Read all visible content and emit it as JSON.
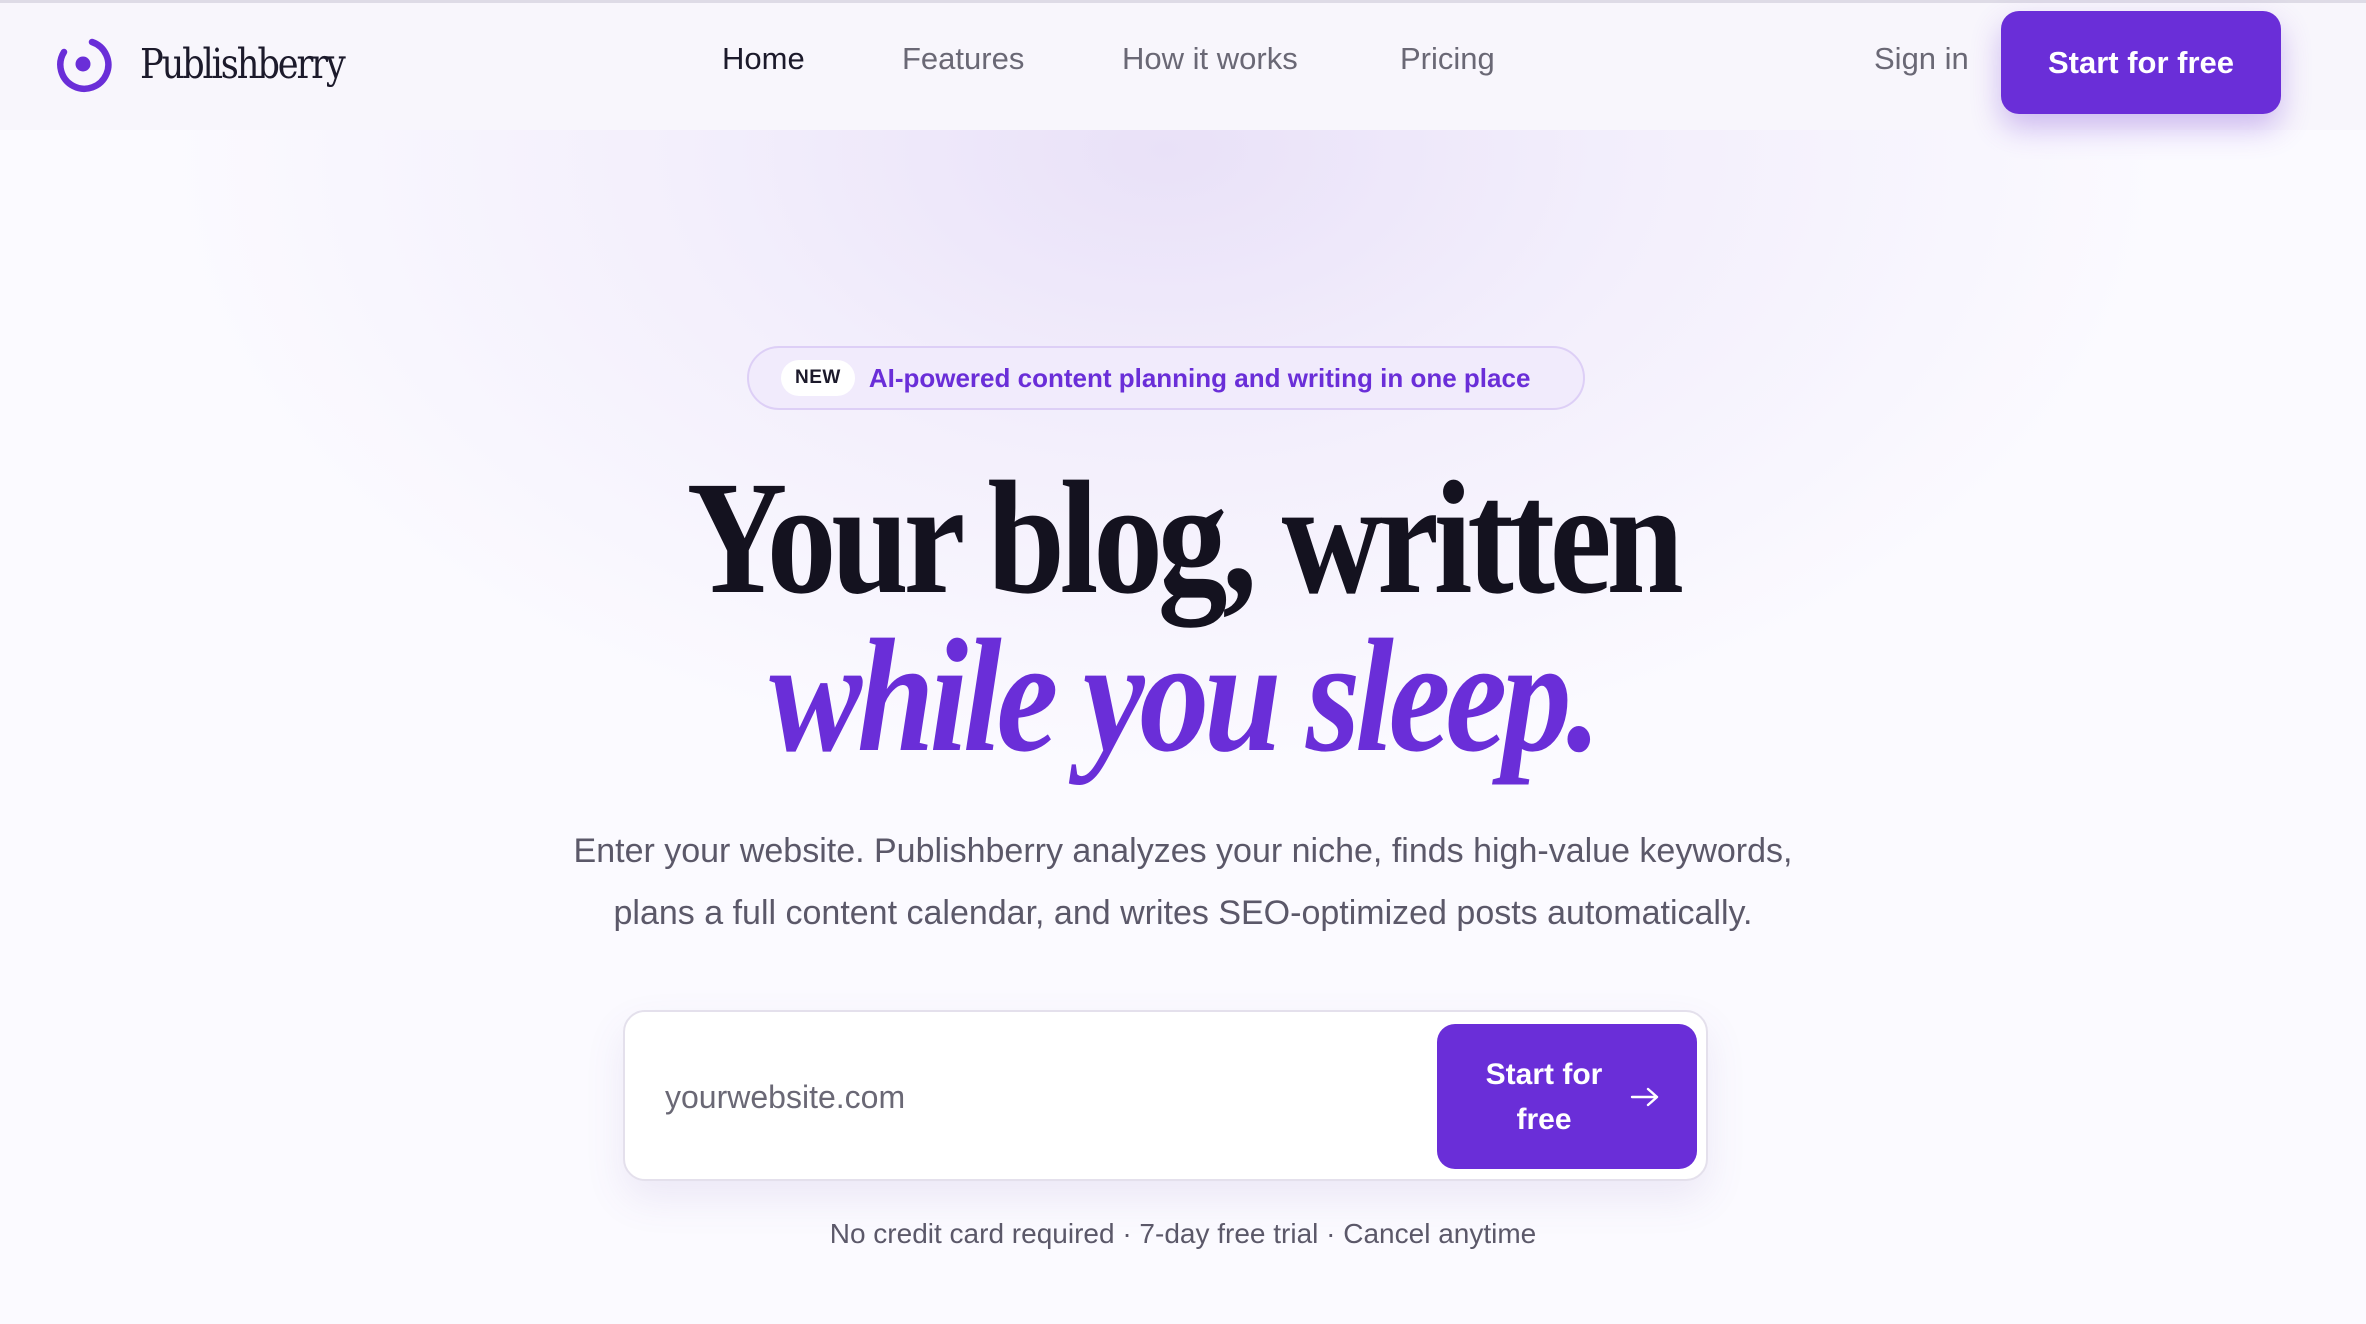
{
  "brand": {
    "name": "Publishberry",
    "logo_icon": "ring-dot-logo-icon",
    "accent": "#6a2ed8"
  },
  "nav": {
    "links": [
      "Home",
      "Features",
      "How it works",
      "Pricing"
    ],
    "active": "Home",
    "sign_in": "Sign in",
    "cta": "Start for free"
  },
  "hero": {
    "badge_tag": "NEW",
    "badge_text": "AI-powered content planning and writing in one place",
    "headline_line1": "Your blog, written",
    "headline_line2": "while you sleep.",
    "subtitle_line1": "Enter your website. Publishberry analyzes your niche, finds high-value keywords,",
    "subtitle_line2": "plans a full content calendar, and writes SEO-optimized posts automatically."
  },
  "form": {
    "input_placeholder": "yourwebsite.com",
    "input_value": "",
    "cta_label": "Start for free",
    "cta_icon": "arrow-right-icon"
  },
  "footnote": "No credit card required · 7-day free trial · Cancel anytime"
}
